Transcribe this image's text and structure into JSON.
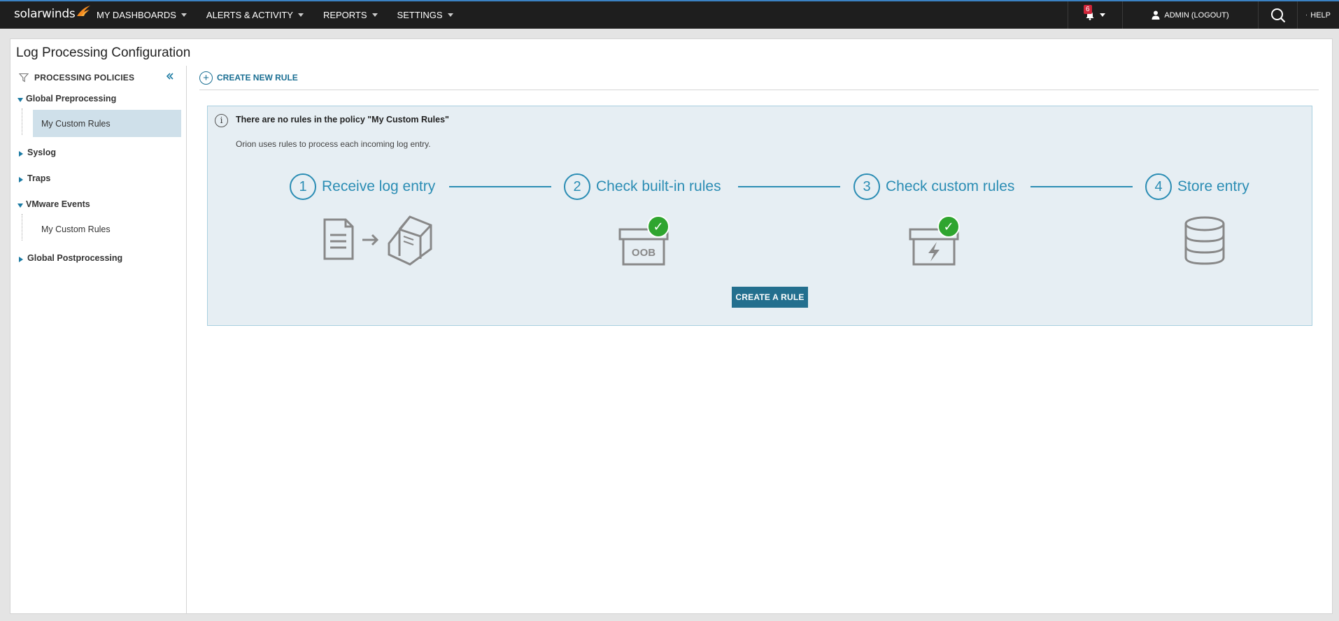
{
  "nav": {
    "logo_text": "solarwinds",
    "menu": [
      {
        "label": "MY DASHBOARDS"
      },
      {
        "label": "ALERTS & ACTIVITY"
      },
      {
        "label": "REPORTS"
      },
      {
        "label": "SETTINGS"
      }
    ],
    "notification_count": "6",
    "user_label": "ADMIN (LOGOUT)",
    "help_label": "HELP"
  },
  "page": {
    "title": "Log Processing Configuration"
  },
  "sidebar": {
    "header": "PROCESSING POLICIES",
    "tree": [
      {
        "label": "Global Preprocessing",
        "expanded": true,
        "children": [
          {
            "label": "My Custom Rules",
            "selected": true
          }
        ]
      },
      {
        "label": "Syslog",
        "expanded": false
      },
      {
        "label": "Traps",
        "expanded": false
      },
      {
        "label": "VMware Events",
        "expanded": true,
        "children": [
          {
            "label": "My Custom Rules",
            "selected": false
          }
        ]
      },
      {
        "label": "Global Postprocessing",
        "expanded": false
      }
    ]
  },
  "toolbar": {
    "create_new_rule": "CREATE NEW RULE"
  },
  "info": {
    "title": "There are no rules in the policy \"My Custom Rules\"",
    "subtitle": "Orion uses rules to process each incoming log entry.",
    "steps": [
      {
        "num": "1",
        "label": "Receive log entry"
      },
      {
        "num": "2",
        "label": "Check built-in rules"
      },
      {
        "num": "3",
        "label": "Check custom rules"
      },
      {
        "num": "4",
        "label": "Store entry"
      }
    ],
    "oob_text": "OOB",
    "cta_label": "CREATE A RULE"
  },
  "colors": {
    "accent": "#2b8db4",
    "button": "#236f8e",
    "nav_bg": "#1e1e1e",
    "selected_bg": "#cfe0ea",
    "info_bg": "#e6eef3",
    "check_green": "#2fa52f",
    "badge_red": "#d0263a"
  }
}
